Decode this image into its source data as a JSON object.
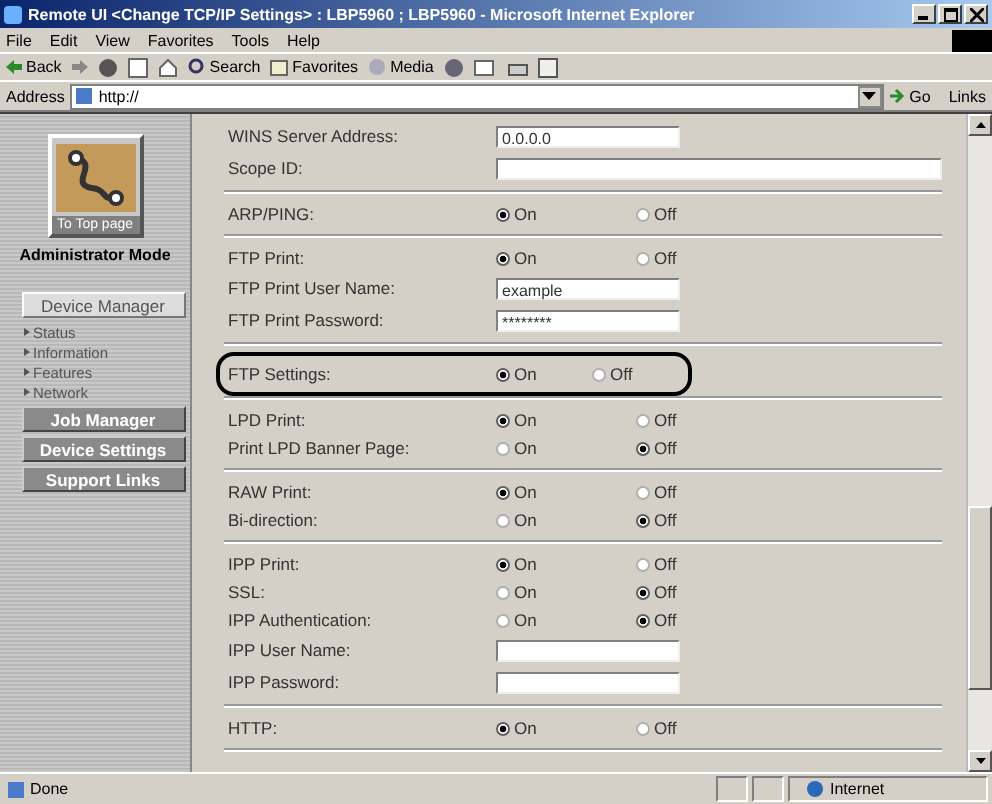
{
  "window": {
    "title": "Remote UI <Change TCP/IP Settings> : LBP5960 ; LBP5960 - Microsoft Internet Explorer"
  },
  "menu": [
    "File",
    "Edit",
    "View",
    "Favorites",
    "Tools",
    "Help"
  ],
  "toolbar": {
    "back": "Back",
    "search": "Search",
    "favorites": "Favorites",
    "media": "Media"
  },
  "address_bar": {
    "label": "Address",
    "value": "http://",
    "go": "Go",
    "links": "Links"
  },
  "sidebar": {
    "top_button": "To Top page",
    "mode": "Administrator Mode",
    "device_manager": "Device Manager",
    "links": [
      "Status",
      "Information",
      "Features",
      "Network"
    ],
    "buttons": [
      "Job Manager",
      "Device Settings",
      "Support Links"
    ]
  },
  "sections": [
    {
      "highlighted": false,
      "rows": [
        {
          "kind": "text",
          "label": "WINS Server Address:",
          "value": "0.0.0.0",
          "wide": false
        },
        {
          "kind": "text",
          "label": "Scope ID:",
          "value": "",
          "wide": true
        }
      ]
    },
    {
      "highlighted": false,
      "rows": [
        {
          "kind": "radio",
          "label": "ARP/PING:",
          "options": [
            {
              "label": "On",
              "selected": true
            },
            {
              "label": "Off",
              "selected": false
            }
          ]
        }
      ]
    },
    {
      "highlighted": false,
      "rows": [
        {
          "kind": "radio",
          "label": "FTP Print:",
          "options": [
            {
              "label": "On",
              "selected": true
            },
            {
              "label": "Off",
              "selected": false
            }
          ]
        },
        {
          "kind": "text",
          "label": "FTP Print User Name:",
          "value": "example",
          "wide": false
        },
        {
          "kind": "text",
          "label": "FTP Print Password:",
          "value": "********",
          "wide": false
        }
      ]
    },
    {
      "highlighted": true,
      "rows": [
        {
          "kind": "radio",
          "label": "FTP Settings:",
          "options": [
            {
              "label": "On",
              "selected": true
            },
            {
              "label": "Off",
              "selected": false
            }
          ]
        }
      ]
    },
    {
      "highlighted": false,
      "rows": [
        {
          "kind": "radio",
          "label": "LPD Print:",
          "options": [
            {
              "label": "On",
              "selected": true
            },
            {
              "label": "Off",
              "selected": false
            }
          ]
        },
        {
          "kind": "radio",
          "label": "Print LPD Banner Page:",
          "options": [
            {
              "label": "On",
              "selected": false
            },
            {
              "label": "Off",
              "selected": true
            }
          ]
        }
      ]
    },
    {
      "highlighted": false,
      "rows": [
        {
          "kind": "radio",
          "label": "RAW Print:",
          "options": [
            {
              "label": "On",
              "selected": true
            },
            {
              "label": "Off",
              "selected": false
            }
          ]
        },
        {
          "kind": "radio",
          "label": "Bi-direction:",
          "options": [
            {
              "label": "On",
              "selected": false
            },
            {
              "label": "Off",
              "selected": true
            }
          ]
        }
      ]
    },
    {
      "highlighted": false,
      "rows": [
        {
          "kind": "radio",
          "label": "IPP Print:",
          "options": [
            {
              "label": "On",
              "selected": true
            },
            {
              "label": "Off",
              "selected": false
            }
          ]
        },
        {
          "kind": "radio",
          "label": "SSL:",
          "options": [
            {
              "label": "On",
              "selected": false
            },
            {
              "label": "Off",
              "selected": true
            }
          ]
        },
        {
          "kind": "radio",
          "label": "IPP Authentication:",
          "options": [
            {
              "label": "On",
              "selected": false
            },
            {
              "label": "Off",
              "selected": true
            }
          ]
        },
        {
          "kind": "text",
          "label": "IPP User Name:",
          "value": "",
          "wide": false
        },
        {
          "kind": "text",
          "label": "IPP Password:",
          "value": "",
          "wide": false
        }
      ]
    },
    {
      "highlighted": false,
      "rows": [
        {
          "kind": "radio",
          "label": "HTTP:",
          "options": [
            {
              "label": "On",
              "selected": true
            },
            {
              "label": "Off",
              "selected": false
            }
          ]
        }
      ]
    }
  ],
  "status_bar": {
    "status": "Done",
    "zone": "Internet"
  }
}
